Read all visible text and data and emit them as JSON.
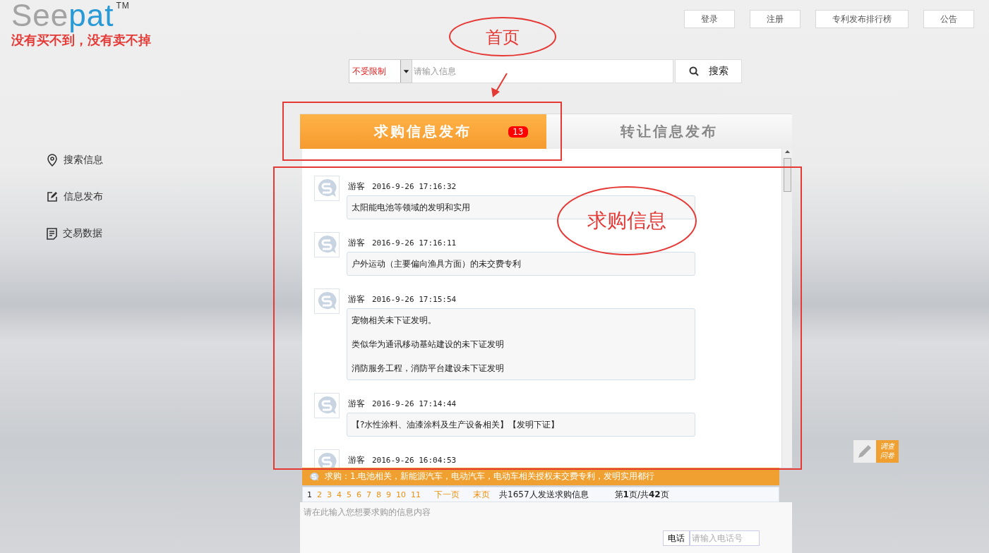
{
  "logo": {
    "parts": [
      "See",
      "pat"
    ],
    "mark": "TM",
    "slogan": "没有买不到，没有卖不掉"
  },
  "top_nav": [
    "登录",
    "注册",
    "专利发布排行榜",
    "公告"
  ],
  "search": {
    "scope": "不受限制",
    "placeholder": "请输入信息",
    "button": "搜索"
  },
  "sidebar": {
    "items": [
      {
        "kind": "pin",
        "label": "搜索信息"
      },
      {
        "kind": "edit",
        "label": "信息发布"
      },
      {
        "kind": "doc",
        "label": "交易数据"
      }
    ]
  },
  "tabs": [
    {
      "label": "求购信息发布",
      "selected": true,
      "badge": "13"
    },
    {
      "label": "转让信息发布",
      "selected": false
    }
  ],
  "messages": [
    {
      "user": "游客",
      "time": "2016-9-26 17:16:32",
      "lines": [
        "太阳能电池等领域的发明和实用"
      ]
    },
    {
      "user": "游客",
      "time": "2016-9-26 17:16:11",
      "lines": [
        "户外运动（主要偏向渔具方面）的未交费专利"
      ]
    },
    {
      "user": "游客",
      "time": "2016-9-26 17:15:54",
      "lines": [
        "宠物相关未下证发明。",
        "类似华为通讯移动基站建设的未下证发明",
        "消防服务工程，消防平台建设未下证发明"
      ]
    },
    {
      "user": "游客",
      "time": "2016-9-26 17:14:44",
      "lines": [
        "【?水性涂料、油漆涂料及生产设备相关】【发明下证】"
      ]
    },
    {
      "user": "游客",
      "time": "2016-9-26 16:04:53"
    }
  ],
  "ticker": "求购：1.电池相关，新能源汽车，电动汽车，电动车相关授权未交费专利，发明实用都行",
  "pagination": {
    "pages": [
      {
        "label": "1",
        "selected": true
      },
      {
        "label": "2",
        "selected": false
      },
      {
        "label": "3",
        "selected": false
      },
      {
        "label": "4",
        "selected": false
      },
      {
        "label": "5",
        "selected": false
      },
      {
        "label": "6",
        "selected": false
      },
      {
        "label": "7",
        "selected": false
      },
      {
        "label": "8",
        "selected": false
      },
      {
        "label": "9",
        "selected": false
      },
      {
        "label": "10",
        "selected": false
      },
      {
        "label": "11",
        "selected": false
      }
    ],
    "next": "下一页",
    "last": "末页",
    "total": "共1657人发送求购信息",
    "page_info": "第**1**页/共**42**页"
  },
  "composer": {
    "placeholder": "请在此输入您想要求购的信息内容",
    "phone_label": "电话",
    "phone_placeholder": "请输入电话号"
  },
  "survey": {
    "label": "调查问卷"
  },
  "annotations": [
    {
      "kind": "ellipse",
      "label": "首页"
    },
    {
      "kind": "arrow"
    },
    {
      "kind": "rect"
    },
    {
      "kind": "rect"
    },
    {
      "kind": "ellipse",
      "label": "求购信息"
    }
  ]
}
